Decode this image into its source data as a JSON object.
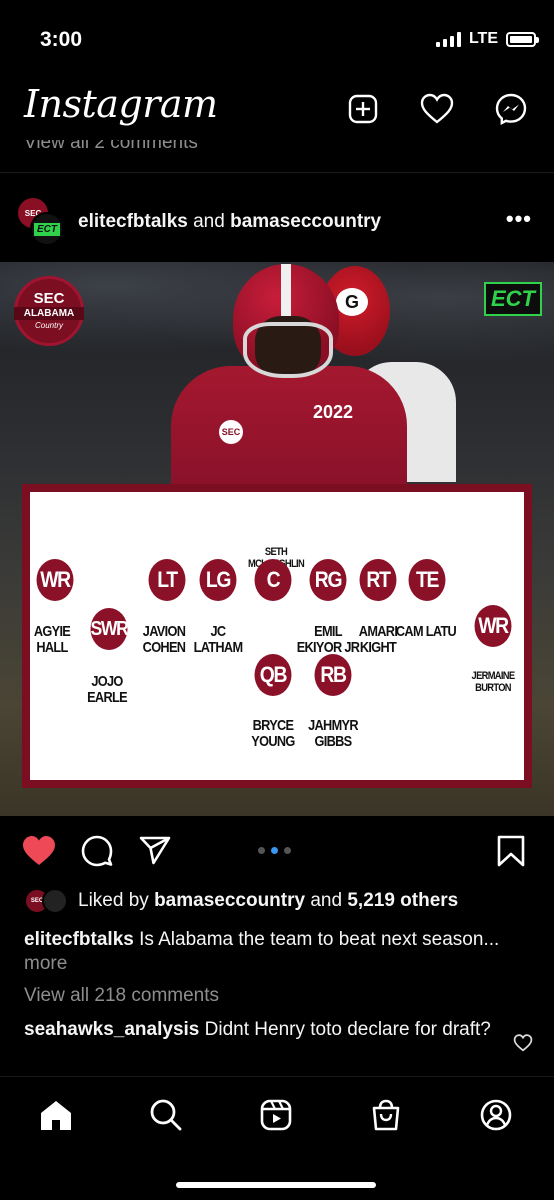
{
  "status_bar": {
    "time": "3:00",
    "network": "LTE",
    "battery_level": 1.0
  },
  "header": {
    "logo": "Instagram",
    "icons": [
      "new-post-icon",
      "heart-icon",
      "messenger-icon"
    ]
  },
  "previous_post": {
    "view_comments": "View all 2 comments"
  },
  "post": {
    "username": "elitecfbtalks",
    "joiner": "and",
    "collaborator": "bamaseccountry",
    "avatar_text": "SEC",
    "collab_avatar_text": "ECT",
    "image": {
      "badge_top": "SEC",
      "badge_mid": "ALABAMA",
      "badge_bottom": "Country",
      "ect_logo": "ECT",
      "jersey_year": "2022",
      "jersey_sec": "SEC",
      "opponent_logo": "G",
      "lineup": {
        "center_name_above": "SETH MCLAUGHLIN",
        "positions": [
          {
            "pos": "WR",
            "name": "AGYIE HALL"
          },
          {
            "pos": "SWR",
            "name": "JOJO EARLE"
          },
          {
            "pos": "LT",
            "name": "JAVION COHEN"
          },
          {
            "pos": "LG",
            "name": "JC LATHAM"
          },
          {
            "pos": "C",
            "name": ""
          },
          {
            "pos": "RG",
            "name": "EMIL EKIYOR JR"
          },
          {
            "pos": "RT",
            "name": "AMARI KIGHT"
          },
          {
            "pos": "TE",
            "name": "CAM LATU"
          },
          {
            "pos": "WR",
            "name": "JERMAINE BURTON"
          },
          {
            "pos": "QB",
            "name": "BRYCE YOUNG"
          },
          {
            "pos": "RB",
            "name": "JAHMYR GIBBS"
          }
        ]
      }
    },
    "carousel": {
      "count": 3,
      "active_index": 1
    },
    "likes": {
      "prefix": "Liked by",
      "liker": "bamaseccountry",
      "joiner": "and",
      "count_text": "5,219 others"
    },
    "caption": {
      "username": "elitecfbtalks",
      "text": "Is Alabama the team to beat next season...",
      "more": "more"
    },
    "view_comments": "View all 218 comments",
    "top_comment": {
      "username": "seahawks_analysis",
      "text": "Didnt Henry toto declare for draft?"
    }
  },
  "tabbar": {
    "tabs": [
      "home-icon",
      "search-icon",
      "reels-icon",
      "shop-icon",
      "profile-icon"
    ]
  },
  "colors": {
    "background": "#000000",
    "like_red": "#ed4956",
    "crimson": "#8a1128",
    "ect_green": "#2fd24a",
    "carousel_active": "#3897f0"
  }
}
